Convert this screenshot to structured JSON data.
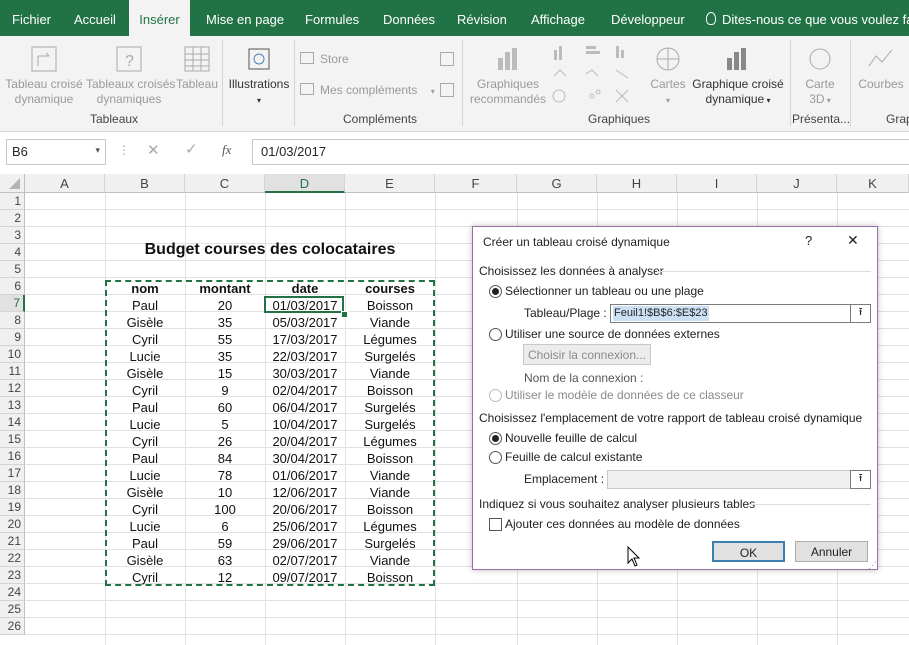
{
  "menu": {
    "tabs": [
      "Fichier",
      "Accueil",
      "Insérer",
      "Mise en page",
      "Formules",
      "Données",
      "Révision",
      "Affichage",
      "Développeur"
    ],
    "active": "Insérer",
    "tell_me": "Dites-nous ce que vous voulez faire"
  },
  "ribbon": {
    "tableaux": {
      "label": "Tableaux",
      "btn1": [
        "Tableau croisé",
        "dynamique"
      ],
      "btn2": [
        "Tableaux croisés",
        "dynamiques"
      ],
      "btn3": "Tableau"
    },
    "illustrations": {
      "label": "Illustrations"
    },
    "complements": {
      "label": "Compléments",
      "store": "Store",
      "mes": "Mes compléments"
    },
    "graphiques": {
      "label": "Graphiques",
      "recommandes": [
        "Graphiques",
        "recommandés"
      ],
      "cartes": "Cartes",
      "croise": [
        "Graphique croisé",
        "dynamique"
      ]
    },
    "presentations": {
      "label": "Présenta...",
      "carte3d": [
        "Carte",
        "3D"
      ]
    },
    "courbes": {
      "label": "Grap",
      "btn": "Courbes"
    }
  },
  "formula_bar": {
    "name_box": "B6",
    "value": "01/03/2017",
    "fx": "fx"
  },
  "grid": {
    "columns": [
      "A",
      "B",
      "C",
      "D",
      "E",
      "F",
      "G",
      "H",
      "I",
      "J",
      "K"
    ],
    "rows": [
      "1",
      "2",
      "3",
      "4",
      "5",
      "6",
      "7",
      "8",
      "9",
      "10",
      "11",
      "12",
      "13",
      "14",
      "15",
      "16",
      "17",
      "18",
      "19",
      "20",
      "21",
      "22",
      "23",
      "24",
      "25",
      "26"
    ],
    "title": "Budget courses des colocataires",
    "headers": [
      "nom",
      "montant",
      "date",
      "courses"
    ],
    "data": [
      [
        "Paul",
        "20",
        "01/03/2017",
        "Boisson"
      ],
      [
        "Gisèle",
        "35",
        "05/03/2017",
        "Viande"
      ],
      [
        "Cyril",
        "55",
        "17/03/2017",
        "Légumes"
      ],
      [
        "Lucie",
        "35",
        "22/03/2017",
        "Surgelés"
      ],
      [
        "Gisèle",
        "15",
        "30/03/2017",
        "Viande"
      ],
      [
        "Cyril",
        "9",
        "02/04/2017",
        "Boisson"
      ],
      [
        "Paul",
        "60",
        "06/04/2017",
        "Surgelés"
      ],
      [
        "Lucie",
        "5",
        "10/04/2017",
        "Surgelés"
      ],
      [
        "Cyril",
        "26",
        "20/04/2017",
        "Légumes"
      ],
      [
        "Paul",
        "84",
        "30/04/2017",
        "Boisson"
      ],
      [
        "Lucie",
        "78",
        "01/06/2017",
        "Viande"
      ],
      [
        "Gisèle",
        "10",
        "12/06/2017",
        "Viande"
      ],
      [
        "Cyril",
        "100",
        "20/06/2017",
        "Boisson"
      ],
      [
        "Lucie",
        "6",
        "25/06/2017",
        "Légumes"
      ],
      [
        "Paul",
        "59",
        "29/06/2017",
        "Surgelés"
      ],
      [
        "Gisèle",
        "63",
        "02/07/2017",
        "Viande"
      ],
      [
        "Cyril",
        "12",
        "09/07/2017",
        "Boisson"
      ]
    ]
  },
  "dialog": {
    "title": "Créer un tableau croisé dynamique",
    "help": "?",
    "close": "✕",
    "section1": "Choisissez les données à analyser",
    "opt_select": "Sélectionner un tableau ou une plage",
    "range_label": "Tableau/Plage :",
    "range_value": "Feuil1!$B$6:$E$23",
    "opt_external": "Utiliser une source de données externes",
    "choose_conn": "Choisir la connexion...",
    "conn_name": "Nom de la connexion :",
    "opt_model": "Utiliser le modèle de données de ce classeur",
    "section2": "Choisissez l'emplacement de votre rapport de tableau croisé dynamique",
    "opt_new": "Nouvelle feuille de calcul",
    "opt_existing": "Feuille de calcul existante",
    "location_label": "Emplacement :",
    "section3": "Indiquez si vous souhaitez analyser plusieurs tables",
    "add_model": "Ajouter ces données au modèle de données",
    "ok": "OK",
    "cancel": "Annuler"
  },
  "colors": {
    "excel_green": "#217346",
    "dialog_border": "#9a6fa8"
  }
}
